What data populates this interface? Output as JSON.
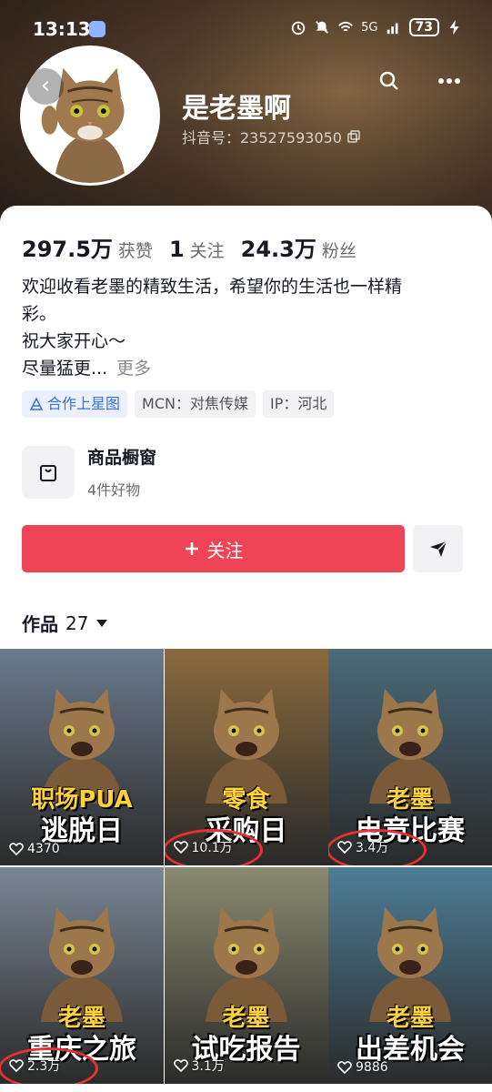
{
  "status_bar": {
    "time": "13:13",
    "network": "5G",
    "battery": "73"
  },
  "profile": {
    "nickname": "是老墨啊",
    "douyin_id": "抖音号：23527593050",
    "stats": [
      {
        "value": "297.5万",
        "label": "获赞"
      },
      {
        "value": "1",
        "label": "关注"
      },
      {
        "value": "24.3万",
        "label": "粉丝"
      }
    ],
    "bio_lines": [
      "欢迎收看老墨的精致生活，希望你的生活也一样精",
      "彩。",
      "祝大家开心～",
      "尽量猛更..."
    ],
    "bio_more": "更多",
    "tags": [
      "合作上星图",
      "MCN：对焦传媒",
      "IP：河北"
    ]
  },
  "shop": {
    "title": "商品橱窗",
    "subtitle": "4件好物"
  },
  "actions": {
    "follow_label": "关注"
  },
  "works": {
    "label": "作品",
    "count": "27"
  },
  "videos": [
    {
      "title": "职场PUA",
      "title2": "逃脱日",
      "likes": "4370",
      "bg": "#6b7a8c",
      "circled": false
    },
    {
      "title": "零食",
      "title2": "采购日",
      "likes": "10.1万",
      "bg": "#8a6a3c",
      "circled": true
    },
    {
      "title": "老墨",
      "title2": "电竞比赛",
      "likes": "3.4万",
      "bg": "#4a6a7a",
      "circled": true
    },
    {
      "title": "老墨",
      "title2": "重庆之旅",
      "likes": "2.3万",
      "bg": "#7a8694",
      "circled": true
    },
    {
      "title": "老墨",
      "title2": "试吃报告",
      "likes": "3.1万",
      "bg": "#8a8a70",
      "circled": false
    },
    {
      "title": "老墨",
      "title2": "出差机会",
      "likes": "9886",
      "bg": "#4d7d96",
      "circled": false
    }
  ],
  "colors": {
    "accent": "#ee4456",
    "tag_blue": "#3a6fd8",
    "annotation": "#e8302f"
  }
}
